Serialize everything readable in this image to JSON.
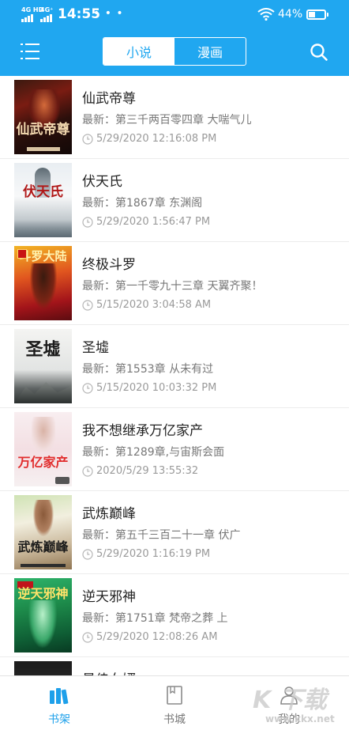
{
  "status_bar": {
    "signal1_label": "4G HD",
    "signal2_label": "4G⁺",
    "time": "14:55",
    "notif_dots": "• • •",
    "battery_percent": "44%",
    "battery_level": 0.44
  },
  "header": {
    "tabs": [
      {
        "label": "小说",
        "active": true
      },
      {
        "label": "漫画",
        "active": false
      }
    ],
    "menu_icon": "hamburger-menu-icon",
    "search_icon": "search-icon"
  },
  "books": [
    {
      "title": "仙武帝尊",
      "latest": "最新：第三千两百零四章 大喘气儿",
      "time": "5/29/2020 12:16:08 PM",
      "cover_title": "仙武帝尊"
    },
    {
      "title": "伏天氏",
      "latest": "最新：第1867章 东渊阁",
      "time": "5/29/2020 1:56:47 PM",
      "cover_title": "伏天氏"
    },
    {
      "title": "终极斗罗",
      "latest": "最新：第一千零九十三章 天翼齐聚！",
      "time": "5/15/2020 3:04:58 AM",
      "cover_title": "斗罗大陆"
    },
    {
      "title": "圣墟",
      "latest": "最新：第1553章 从未有过",
      "time": "5/15/2020 10:03:32 PM",
      "cover_title": "圣墟"
    },
    {
      "title": "我不想继承万亿家产",
      "latest": "最新：第1289章,与宙斯会面",
      "time": "2020/5/29 13:55:32",
      "cover_title": "万亿家产"
    },
    {
      "title": "武炼巅峰",
      "latest": "最新：第五千三百二十一章 伏广",
      "time": "5/29/2020 1:16:19 PM",
      "cover_title": "武炼巅峰"
    },
    {
      "title": "逆天邪神",
      "latest": "最新：第1751章 梵帝之葬 上",
      "time": "5/29/2020 12:08:26 AM",
      "cover_title": "逆天邪神"
    },
    {
      "title": "最佳女婿",
      "latest": "",
      "time": "",
      "cover_title": ""
    }
  ],
  "bottom_nav": [
    {
      "label": "书架",
      "icon": "bookshelf-icon",
      "active": true
    },
    {
      "label": "书城",
      "icon": "book-icon",
      "active": false
    },
    {
      "label": "我的",
      "icon": "person-icon",
      "active": false
    }
  ],
  "watermark": {
    "brand": "K 下载",
    "url": "www.kkx.net"
  },
  "colors": {
    "accent": "#20a7f0",
    "title_text": "#222222",
    "secondary_text": "#777777",
    "time_text": "#9a9a9a"
  }
}
